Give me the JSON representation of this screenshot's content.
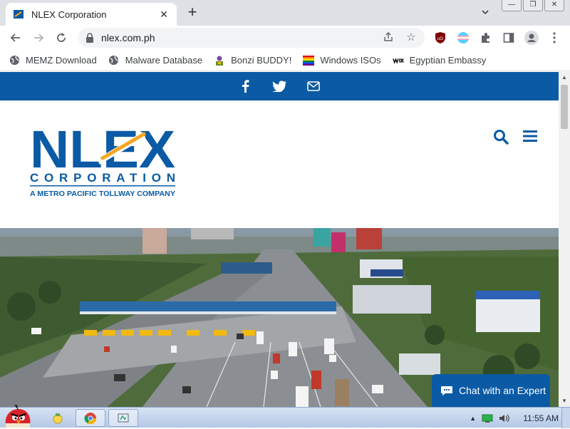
{
  "browser": {
    "tab_title": "NLEX Corporation",
    "new_tab_label": "+",
    "url": "nlex.com.ph"
  },
  "bookmarks": [
    {
      "label": "MEMZ Download",
      "icon": "globe-icon"
    },
    {
      "label": "Malware Database",
      "icon": "globe-icon"
    },
    {
      "label": "Bonzi BUDDY!",
      "icon": "bonzi-icon"
    },
    {
      "label": "Windows ISOs",
      "icon": "rainbow-flag-icon"
    },
    {
      "label": "Egyptian Embassy",
      "icon": "wix-icon"
    }
  ],
  "site": {
    "logo_word": "NLEX",
    "logo_corp": "CORPORATION",
    "logo_tagline": "A METRO PACIFIC TOLLWAY COMPANY",
    "brand_color": "#0a5aa5",
    "chat_label": "Chat with an Expert"
  },
  "taskbar": {
    "time": "11:55 AM"
  }
}
